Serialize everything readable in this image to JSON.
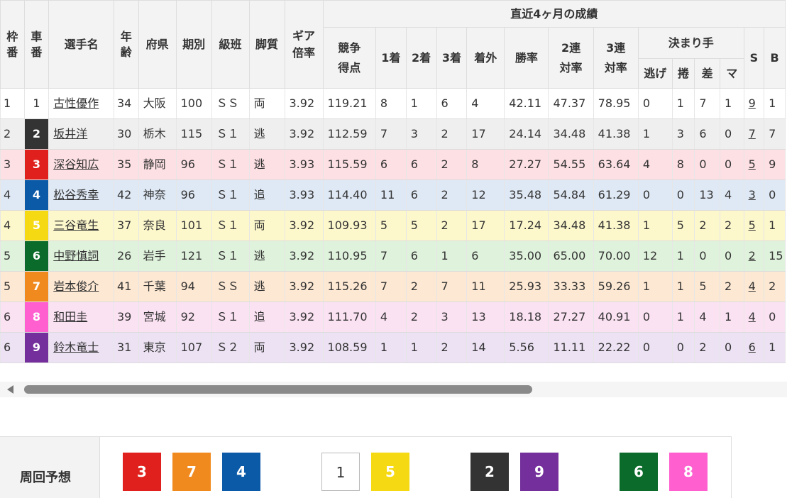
{
  "headers": {
    "frame": "枠番",
    "car": "車番",
    "name": "選手名",
    "age": "年齢",
    "pref": "府県",
    "term": "期別",
    "class": "級班",
    "style": "脚質",
    "gear": "ギア倍率",
    "recent": "直近4ヶ月の成績",
    "score": "競争得点",
    "first": "1着",
    "second": "2着",
    "third": "3着",
    "outside": "着外",
    "win_rate": "勝率",
    "top2_rate": "2連対率",
    "top3_rate": "3連対率",
    "kimarite": "決まり手",
    "nige": "逃げ",
    "makuri": "捲",
    "sashi": "差",
    "mark": "マ",
    "s": "S",
    "b": "B"
  },
  "riders": [
    {
      "frame": "1",
      "car": "1",
      "name": "古性優作",
      "age": "34",
      "pref": "大阪",
      "term": "100",
      "class": "ＳＳ",
      "style": "両",
      "gear": "3.92",
      "score": "119.21",
      "first": "8",
      "second": "1",
      "third": "6",
      "outside": "4",
      "win_rate": "42.11",
      "top2_rate": "47.37",
      "top3_rate": "78.95",
      "nige": "0",
      "makuri": "1",
      "sashi": "7",
      "mark": "1",
      "s": "9",
      "b": "1"
    },
    {
      "frame": "2",
      "car": "2",
      "name": "坂井洋",
      "age": "30",
      "pref": "栃木",
      "term": "115",
      "class": "Ｓ１",
      "style": "逃",
      "gear": "3.92",
      "score": "112.59",
      "first": "7",
      "second": "3",
      "third": "2",
      "outside": "17",
      "win_rate": "24.14",
      "top2_rate": "34.48",
      "top3_rate": "41.38",
      "nige": "1",
      "makuri": "3",
      "sashi": "6",
      "mark": "0",
      "s": "7",
      "b": "7"
    },
    {
      "frame": "3",
      "car": "3",
      "name": "深谷知広",
      "age": "35",
      "pref": "静岡",
      "term": "96",
      "class": "Ｓ１",
      "style": "逃",
      "gear": "3.93",
      "score": "115.59",
      "first": "6",
      "second": "6",
      "third": "2",
      "outside": "8",
      "win_rate": "27.27",
      "top2_rate": "54.55",
      "top3_rate": "63.64",
      "nige": "4",
      "makuri": "8",
      "sashi": "0",
      "mark": "0",
      "s": "5",
      "b": "9"
    },
    {
      "frame": "4",
      "car": "4",
      "name": "松谷秀幸",
      "age": "42",
      "pref": "神奈",
      "term": "96",
      "class": "Ｓ１",
      "style": "追",
      "gear": "3.93",
      "score": "114.40",
      "first": "11",
      "second": "6",
      "third": "2",
      "outside": "12",
      "win_rate": "35.48",
      "top2_rate": "54.84",
      "top3_rate": "61.29",
      "nige": "0",
      "makuri": "0",
      "sashi": "13",
      "mark": "4",
      "s": "3",
      "b": "0"
    },
    {
      "frame": "4",
      "car": "5",
      "name": "三谷竜生",
      "age": "37",
      "pref": "奈良",
      "term": "101",
      "class": "Ｓ１",
      "style": "両",
      "gear": "3.92",
      "score": "109.93",
      "first": "5",
      "second": "5",
      "third": "2",
      "outside": "17",
      "win_rate": "17.24",
      "top2_rate": "34.48",
      "top3_rate": "41.38",
      "nige": "1",
      "makuri": "5",
      "sashi": "2",
      "mark": "2",
      "s": "5",
      "b": "1"
    },
    {
      "frame": "5",
      "car": "6",
      "name": "中野慎詞",
      "age": "26",
      "pref": "岩手",
      "term": "121",
      "class": "Ｓ１",
      "style": "逃",
      "gear": "3.92",
      "score": "110.95",
      "first": "7",
      "second": "6",
      "third": "1",
      "outside": "6",
      "win_rate": "35.00",
      "top2_rate": "65.00",
      "top3_rate": "70.00",
      "nige": "12",
      "makuri": "1",
      "sashi": "0",
      "mark": "0",
      "s": "2",
      "b": "15"
    },
    {
      "frame": "5",
      "car": "7",
      "name": "岩本俊介",
      "age": "41",
      "pref": "千葉",
      "term": "94",
      "class": "ＳＳ",
      "style": "逃",
      "gear": "3.92",
      "score": "115.26",
      "first": "7",
      "second": "2",
      "third": "7",
      "outside": "11",
      "win_rate": "25.93",
      "top2_rate": "33.33",
      "top3_rate": "59.26",
      "nige": "1",
      "makuri": "1",
      "sashi": "5",
      "mark": "2",
      "s": "4",
      "b": "2"
    },
    {
      "frame": "6",
      "car": "8",
      "name": "和田圭",
      "age": "39",
      "pref": "宮城",
      "term": "92",
      "class": "Ｓ１",
      "style": "追",
      "gear": "3.92",
      "score": "111.70",
      "first": "4",
      "second": "2",
      "third": "3",
      "outside": "13",
      "win_rate": "18.18",
      "top2_rate": "27.27",
      "top3_rate": "40.91",
      "nige": "0",
      "makuri": "1",
      "sashi": "4",
      "mark": "1",
      "s": "4",
      "b": "0"
    },
    {
      "frame": "6",
      "car": "9",
      "name": "鈴木竜士",
      "age": "31",
      "pref": "東京",
      "term": "107",
      "class": "Ｓ２",
      "style": "両",
      "gear": "3.92",
      "score": "108.59",
      "first": "1",
      "second": "1",
      "third": "2",
      "outside": "14",
      "win_rate": "5.56",
      "top2_rate": "11.11",
      "top3_rate": "22.22",
      "nige": "0",
      "makuri": "0",
      "sashi": "2",
      "mark": "0",
      "s": "6",
      "b": "1"
    }
  ],
  "car_colors": {
    "1": "#ffffff",
    "2": "#333333",
    "3": "#e0201c",
    "4": "#0b5aa8",
    "5": "#f5d912",
    "6": "#0a6b2a",
    "7": "#f08a1e",
    "8": "#ff5fcf",
    "9": "#742f9c"
  },
  "prediction": {
    "label": "周回予想",
    "order": [
      "3",
      "7",
      "4",
      "1",
      "5",
      "2",
      "9",
      "6",
      "8"
    ]
  }
}
